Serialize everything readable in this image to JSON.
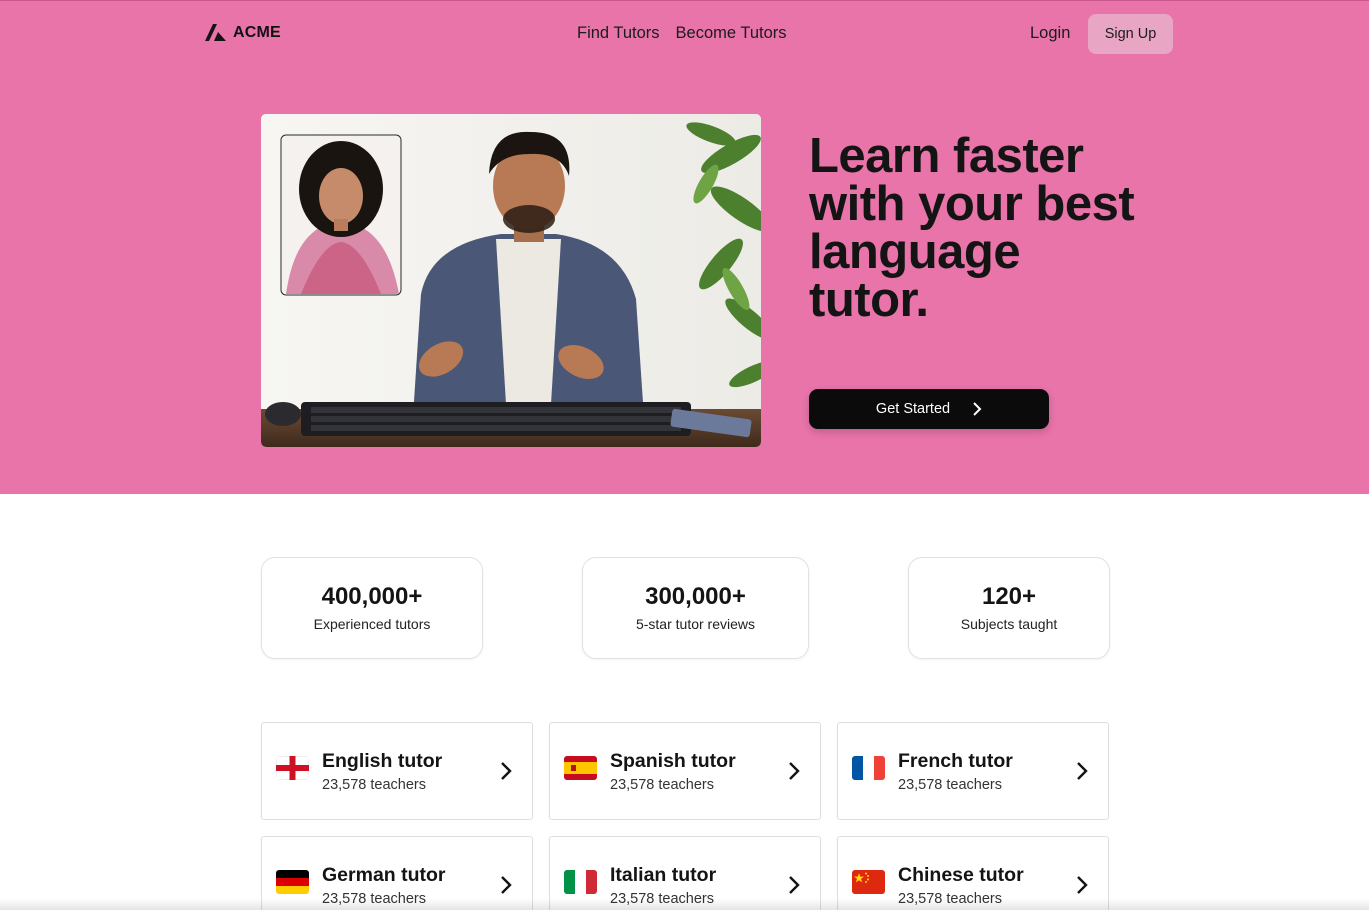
{
  "nav": {
    "brand": "ACME",
    "links": [
      "Find Tutors",
      "Become Tutors"
    ],
    "login_label": "Login",
    "signup_label": "Sign Up"
  },
  "hero": {
    "headline": "Learn faster with your best language tutor.",
    "cta_label": "Get Started",
    "background_color": "#e874a9"
  },
  "stats": [
    {
      "value": "400,000+",
      "label": "Experienced tutors"
    },
    {
      "value": "300,000+",
      "label": "5-star tutor reviews"
    },
    {
      "value": "120+",
      "label": "Subjects taught"
    }
  ],
  "tutors": [
    {
      "name": "English tutor",
      "count": "23,578 teachers",
      "flag": "england"
    },
    {
      "name": "Spanish tutor",
      "count": "23,578 teachers",
      "flag": "spain"
    },
    {
      "name": "French tutor",
      "count": "23,578 teachers",
      "flag": "france"
    },
    {
      "name": "German tutor",
      "count": "23,578 teachers",
      "flag": "germany"
    },
    {
      "name": "Italian tutor",
      "count": "23,578 teachers",
      "flag": "italy"
    },
    {
      "name": "Chinese tutor",
      "count": "23,578 teachers",
      "flag": "china"
    }
  ]
}
